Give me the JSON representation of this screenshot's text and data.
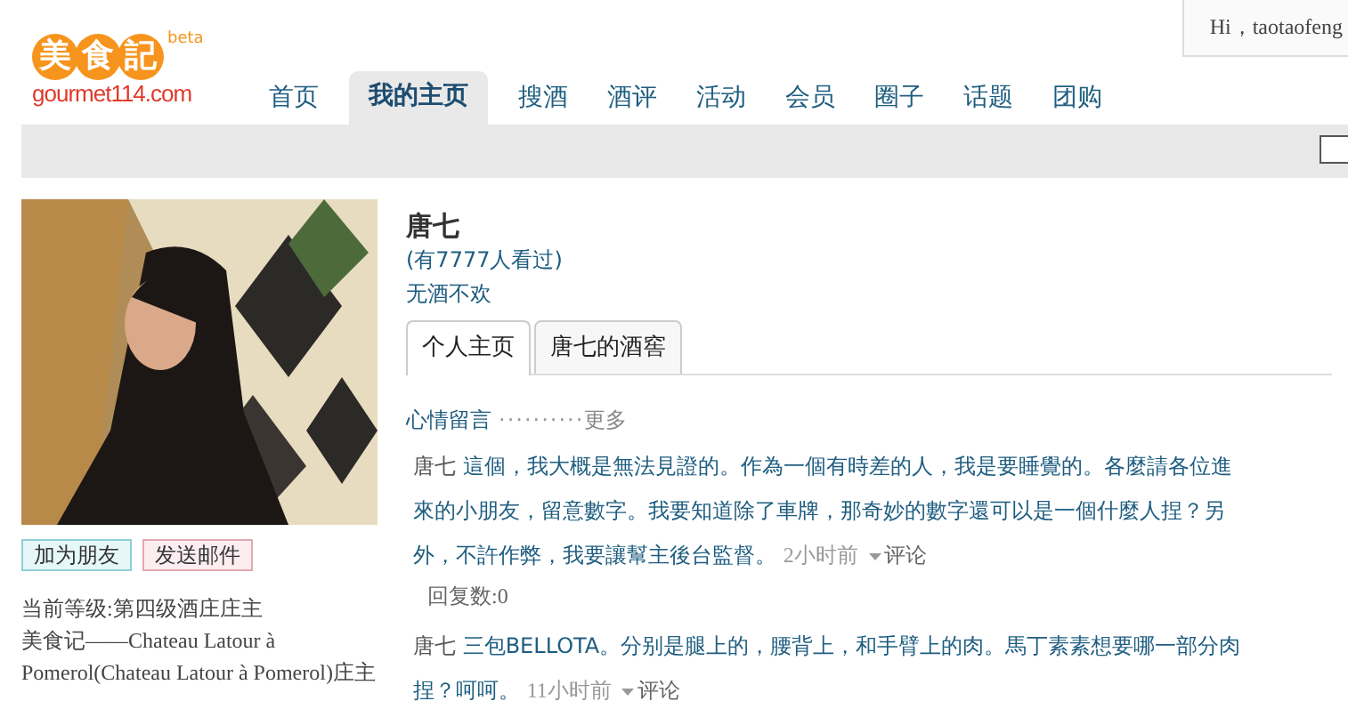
{
  "logo": {
    "chars": [
      "美",
      "食",
      "記"
    ],
    "badge": "beta",
    "domain": "gourmet114.com"
  },
  "greeting": "Hi，taotaofeng",
  "nav": [
    {
      "label": "首页",
      "selected": false
    },
    {
      "label": "我的主页",
      "selected": true
    },
    {
      "label": "搜酒",
      "selected": false
    },
    {
      "label": "酒评",
      "selected": false
    },
    {
      "label": "活动",
      "selected": false
    },
    {
      "label": "会员",
      "selected": false
    },
    {
      "label": "圈子",
      "selected": false
    },
    {
      "label": "话题",
      "selected": false
    },
    {
      "label": "团购",
      "selected": false
    }
  ],
  "profile": {
    "photo": {
      "kind": "picture"
    },
    "buttons": [
      {
        "label": "加为朋友",
        "kind": "friend"
      },
      {
        "label": "发送邮件",
        "kind": "mail"
      }
    ],
    "info": [
      "当前等级:第四级酒庄庄主",
      "美食记——Chateau Latour à Pomerol(Chateau Latour à Pomerol)庄主"
    ]
  },
  "user": {
    "name": "唐七",
    "views": "(有7777人看过)",
    "motto": "无酒不欢"
  },
  "tabs": [
    {
      "label": "个人主页",
      "selected": true
    },
    {
      "label": "唐七的酒窖",
      "selected": false
    }
  ],
  "section": {
    "title": "心情留言",
    "dots": "··········",
    "more": "更多"
  },
  "posts": [
    {
      "author": "唐七",
      "text": "這個，我大概是無法見證的。作為一個有時差的人，我是要睡覺的。各麼請各位進來的小朋友，留意數字。我要知道除了車牌，那奇妙的數字還可以是一個什麼人捏？另外，不許作弊，我要讓幫主後台監督。",
      "time": "2小时前",
      "action": "评论",
      "replies": "回复数:0"
    },
    {
      "author": "唐七",
      "text": "三包BELLOTA。分别是腿上的，腰背上，和手臂上的肉。馬丁素素想要哪一部分肉捏？呵呵。",
      "time": "11小时前",
      "action": "评论"
    }
  ]
}
